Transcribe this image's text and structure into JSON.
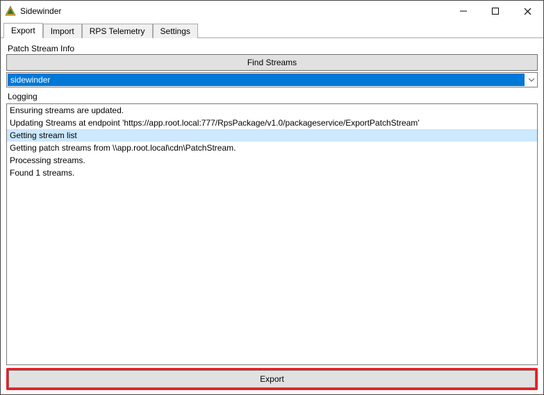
{
  "window": {
    "title": "Sidewinder"
  },
  "tabs": {
    "export": "Export",
    "import": "Import",
    "rps": "RPS Telemetry",
    "settings": "Settings"
  },
  "patchStream": {
    "groupLabel": "Patch Stream Info",
    "findButton": "Find Streams",
    "selected": "sidewinder"
  },
  "logging": {
    "groupLabel": "Logging",
    "lines": [
      "Ensuring streams are updated.",
      "Updating Streams at endpoint 'https://app.root.local:777/RpsPackage/v1.0/packageservice/ExportPatchStream'",
      "Getting stream list",
      "Getting patch streams from \\\\app.root.local\\cdn\\PatchStream.",
      "Processing streams.",
      "Found 1 streams."
    ],
    "selectedIndex": 2
  },
  "exportButton": "Export"
}
